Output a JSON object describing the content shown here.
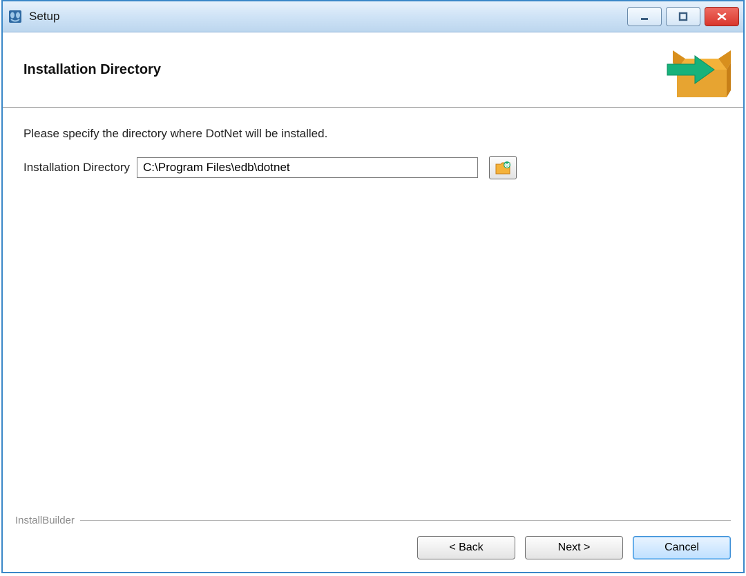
{
  "window": {
    "title": "Setup"
  },
  "header": {
    "title": "Installation Directory"
  },
  "body": {
    "prompt": "Please specify the directory where DotNet will be installed.",
    "field_label": "Installation Directory",
    "directory_value": "C:\\Program Files\\edb\\dotnet"
  },
  "footer": {
    "brand": "InstallBuilder",
    "buttons": {
      "back": "< Back",
      "next": "Next >",
      "cancel": "Cancel"
    }
  }
}
